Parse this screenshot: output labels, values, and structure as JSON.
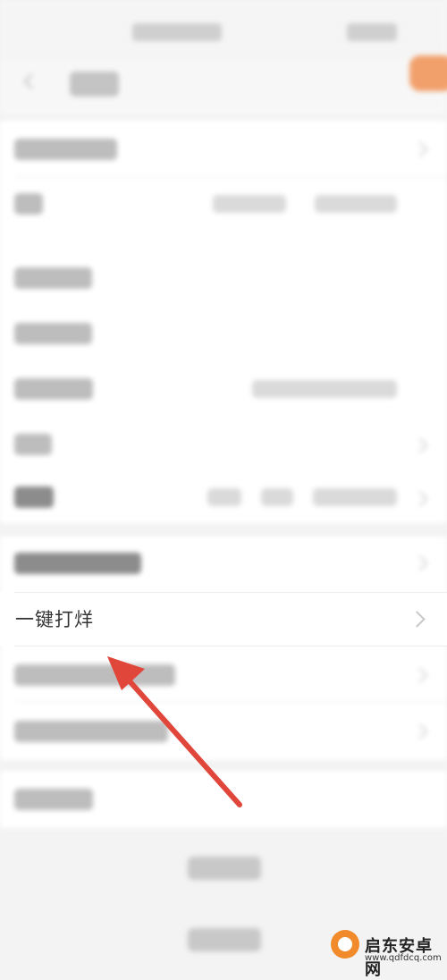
{
  "one_click_row": {
    "label": "一键打烊"
  },
  "watermark": {
    "name": "启东安卓网",
    "url": "www.qdfdcq.com"
  },
  "colors": {
    "accent": "#f2a06b",
    "arrow": "#e0463a",
    "watermark": "#f08a2a"
  }
}
